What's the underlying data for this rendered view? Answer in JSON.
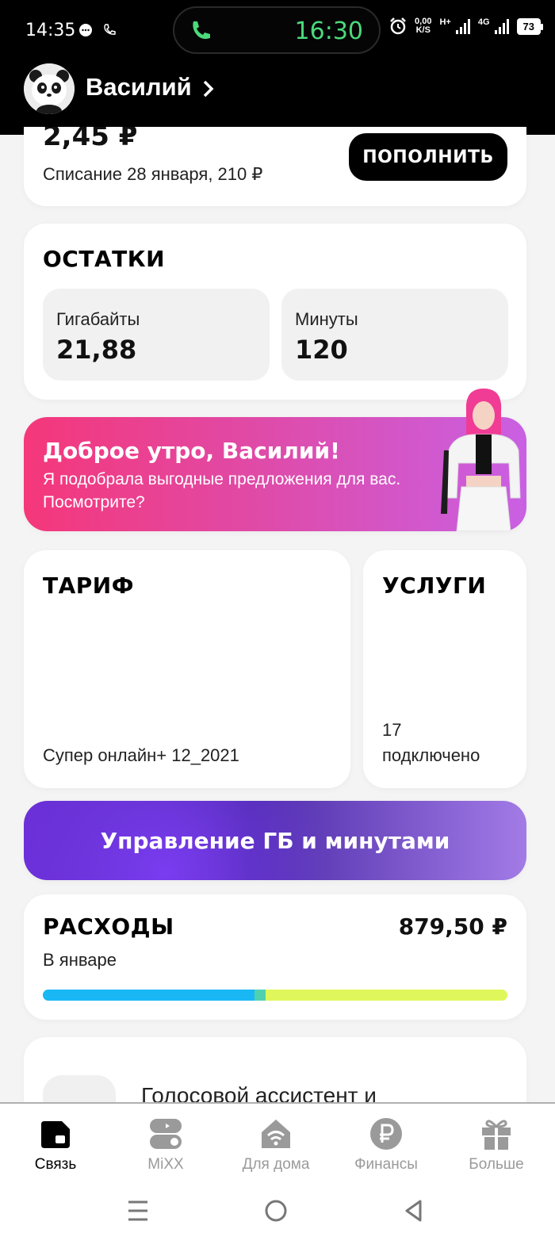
{
  "status_bar": {
    "time": "14:35",
    "call_time": "16:30",
    "net_speed_value": "0,00",
    "net_speed_unit": "K/S",
    "network1": "H+",
    "network2": "4G",
    "battery": "73"
  },
  "header": {
    "user_name": "Василий"
  },
  "balance": {
    "amount": "2,45 ₽",
    "debit_note": "Списание 28 января, 210 ₽",
    "topup_label": "ПОПОЛНИТЬ"
  },
  "remaining": {
    "title": "ОСТАТКИ",
    "gb_label": "Гигабайты",
    "gb_value": "21,88",
    "min_label": "Минуты",
    "min_value": "120"
  },
  "promo": {
    "title": "Доброе утро, Василий!",
    "text": "Я подобрала выгодные предложения для вас. Посмотрите?"
  },
  "tariff": {
    "title": "ТАРИФ",
    "name": "Супер онлайн+ 12_2021"
  },
  "services": {
    "title": "УСЛУГИ",
    "count": "17",
    "status": "подключено"
  },
  "manage": {
    "label": "Управление ГБ и минутами"
  },
  "expenses": {
    "title": "РАСХОДЫ",
    "amount": "879,50 ₽",
    "period": "В январе",
    "progress": [
      0.455,
      0.025,
      0.52
    ],
    "colors": [
      "#19b8f5",
      "#4fd1b0",
      "#dff75a"
    ]
  },
  "assistant": {
    "title": "Голосовой ассистент и"
  },
  "bottom_nav": {
    "items": [
      {
        "label": "Связь",
        "icon": "sim-card-icon",
        "active": true
      },
      {
        "label": "MiXX",
        "icon": "toggle-icon",
        "active": false
      },
      {
        "label": "Для дома",
        "icon": "home-wifi-icon",
        "active": false
      },
      {
        "label": "Финансы",
        "icon": "ruble-icon",
        "active": false
      },
      {
        "label": "Больше",
        "icon": "gift-icon",
        "active": false
      }
    ]
  },
  "colors": {
    "accent_pink": "#f5377a",
    "accent_purple": "#6a2ed6",
    "call_green": "#4cd97a"
  }
}
